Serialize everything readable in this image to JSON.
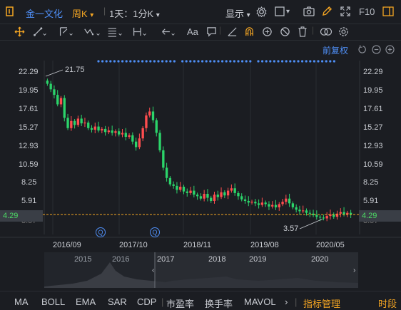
{
  "toolbar": {
    "menu_icon": "bracket-menu-icon",
    "stock_name": "金一文化",
    "period": "周K",
    "period_arrow": "▾",
    "sub_period": "1天：1分K",
    "sub_period_arrow": "▾",
    "display_label": "显示",
    "display_arrow": "▾",
    "f10_label": "F10"
  },
  "drawing_tools": {
    "text_tool": "Aa"
  },
  "chart": {
    "adjust_label": "前复权",
    "y_ticks": [
      "22.29",
      "19.95",
      "17.61",
      "15.27",
      "12.93",
      "10.59",
      "8.25",
      "5.91",
      "4.29",
      "3.57"
    ],
    "current_price": "4.29",
    "x_ticks": [
      "2016/09",
      "2017/10",
      "2018/11",
      "2019/08",
      "2020/05"
    ],
    "high_label": "21.75",
    "low_label": "3.57",
    "event_marker": "Q",
    "accent_blue": "#4f8ff7",
    "up_color": "#ff4d4f",
    "down_color": "#2bd46a",
    "price_line_color": "#f5a623"
  },
  "chart_data": {
    "type": "candlestick",
    "y_ticks": [
      22.29,
      19.95,
      17.61,
      15.27,
      12.93,
      10.59,
      8.25,
      5.91,
      3.57
    ],
    "x_tick_labels": [
      "2016/09",
      "2017/10",
      "2018/11",
      "2019/08",
      "2020/05"
    ],
    "last_price": 4.29,
    "max_marked": 21.75,
    "min_marked": 3.57,
    "trend_series": [
      20.8,
      20.1,
      19.4,
      18.2,
      19.0,
      16.5,
      15.2,
      16.1,
      15.6,
      16.4,
      15.8,
      15.9,
      15.2,
      15.0,
      15.4,
      14.9,
      15.1,
      14.7,
      14.9,
      14.6,
      14.8,
      14.4,
      14.6,
      14.1,
      14.3,
      13.5,
      12.8,
      13.9,
      15.2,
      16.8,
      17.3,
      16.2,
      14.6,
      12.4,
      10.2,
      8.9,
      8.1,
      7.9,
      7.4,
      7.8,
      7.2,
      7.0,
      7.3,
      6.8,
      6.6,
      6.3,
      6.9,
      6.4,
      6.0,
      6.8,
      6.5,
      7.1,
      6.7,
      7.3,
      7.6,
      7.0,
      6.6,
      6.2,
      6.0,
      5.8,
      5.9,
      5.7,
      5.5,
      5.8,
      5.6,
      5.3,
      5.5,
      5.2,
      5.6,
      5.9,
      6.3,
      5.7,
      5.2,
      4.9,
      4.7,
      4.8,
      4.5,
      4.4,
      4.2,
      4.0,
      3.9,
      3.8,
      4.1,
      4.3,
      4.0,
      4.4,
      4.6,
      4.3,
      4.5,
      4.29
    ]
  },
  "navigator": {
    "years": [
      "2015",
      "2016",
      "2017",
      "2018",
      "2019",
      "2020"
    ]
  },
  "bottom_bar": {
    "items": [
      "MA",
      "BOLL",
      "EMA",
      "SAR",
      "CDP",
      "市盈率",
      "换手率",
      "MAVOL"
    ],
    "more": "›",
    "manage": "指标管理",
    "right": "时段"
  }
}
